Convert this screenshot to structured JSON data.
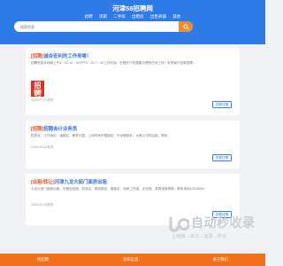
{
  "header": {
    "title": "河津58招聘网",
    "nav": [
      "招聘",
      "求职",
      "二手房",
      "出租房",
      "出售商铺",
      "其他"
    ]
  },
  "search": {
    "placeholder": "搜索信息"
  },
  "listings": [
    {
      "tag": "[招聘]",
      "title": "诚合宏利的工作来喽！",
      "desc": "招聘信息本地网上午8：00-12：00下午2：00-7：00工作内容：在理疗户机搭建代理的任何工作！负责客户回家招聘...",
      "date": "2025-07-07发布",
      "thumb_text_big": "招聘",
      "thumb_text_small": "诚聘",
      "button": "查看详情"
    },
    {
      "tag": "[招聘]",
      "title": "招聘会计业务员",
      "desc": "性质女，工作地区：诸城区，薪资元整，上班时间不限固定，不设薪制补，大家公平机会制，联系...",
      "date": "2025-05-24发布",
      "button": "查看详情"
    },
    {
      "tag": "[出租/转让]",
      "title": "河津九龙大街门面房出租",
      "desc": "九龙大街门面房出租，可做包括馆、奶茶店、美容美发、服装店、电商工作室、文化馆、茶具电商等等，联系电话15303594...",
      "date": "2025-03-25发布",
      "button": "查看详情"
    }
  ],
  "footer": {
    "items": [
      "找招聘",
      "发布信息",
      "关于我们"
    ]
  },
  "watermark": {
    "name": "自动秒收录",
    "sub": "上链接→来访→收录→排名"
  },
  "colors": {
    "header": "#2e7ae6",
    "accent": "#f08a2c",
    "footer": "#f2711c",
    "title_link": "#3a6fd8",
    "tag_red": "#e9522c"
  }
}
